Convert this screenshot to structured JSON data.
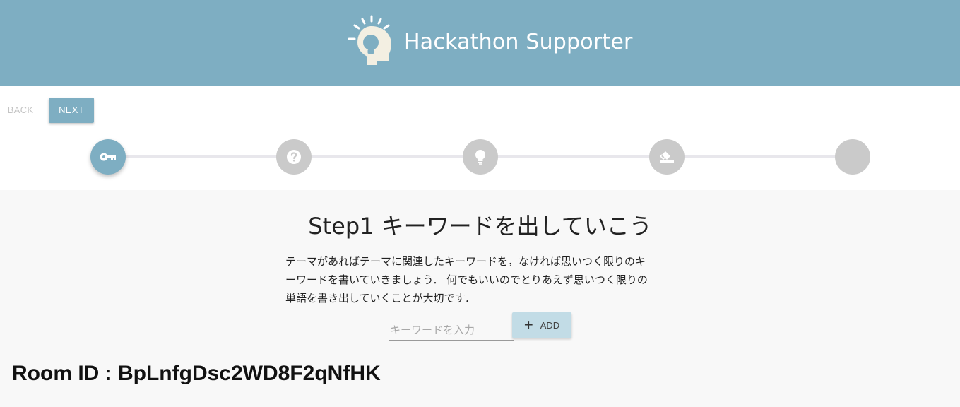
{
  "header": {
    "app_title": "Hackathon Supporter",
    "logo_icon": "lightbulb-head-icon",
    "background": "#7eaec2"
  },
  "nav": {
    "back_label": "BACK",
    "next_label": "NEXT"
  },
  "stepper": {
    "active_color": "#7eaec2",
    "inactive_color": "#cacaca",
    "steps": [
      {
        "icon": "key-icon",
        "active": true
      },
      {
        "icon": "question-icon",
        "active": false
      },
      {
        "icon": "lightbulb-icon",
        "active": false
      },
      {
        "icon": "eraser-icon",
        "active": false
      },
      {
        "icon": "",
        "active": false
      }
    ]
  },
  "main": {
    "title": "Step1 キーワードを出していこう",
    "description_lines": [
      "テーマがあればテーマに関連したキーワードを，なければ思いつく限りのキ",
      "ーワードを書いていきましょう． 何でもいいのでとりあえず思いつく限りの",
      "単語を書き出していくことが大切です．"
    ],
    "keyword_input": {
      "placeholder": "キーワードを入力",
      "value": ""
    },
    "add_label": "ADD",
    "add_icon": "plus-icon"
  },
  "room": {
    "label": "Room ID : BpLnfgDsc2WD8F2qNfHK"
  }
}
